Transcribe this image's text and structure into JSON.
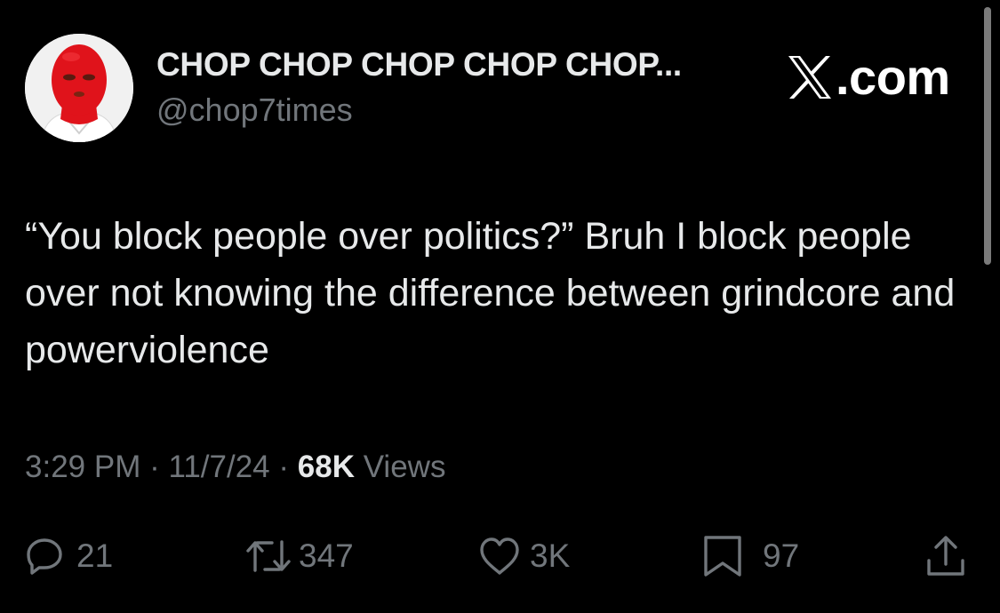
{
  "author": {
    "display_name": "CHOP CHOP CHOP CHOP CHOP...",
    "handle": "@chop7times",
    "avatar": "avatar-red-ski-mask"
  },
  "brand": {
    "icon": "x-logo-icon",
    "text": ".com"
  },
  "tweet": {
    "text": "“You block people over politics?” Bruh I block people over not knowing the difference between grindcore and powerviolence",
    "time": "3:29 PM",
    "separator": " · ",
    "date": "11/7/24",
    "views_count": "68K",
    "views_label": " Views"
  },
  "actions": {
    "reply": {
      "icon": "reply-icon",
      "count": "21"
    },
    "retweet": {
      "icon": "retweet-icon",
      "count": "347"
    },
    "like": {
      "icon": "heart-icon",
      "count": "3K"
    },
    "bookmark": {
      "icon": "bookmark-icon",
      "count": "97"
    },
    "share": {
      "icon": "share-icon"
    }
  },
  "colors": {
    "background": "#000000",
    "text_primary": "#e7e9ea",
    "text_secondary": "#71767b",
    "avatar_mask": "#e0131b"
  }
}
